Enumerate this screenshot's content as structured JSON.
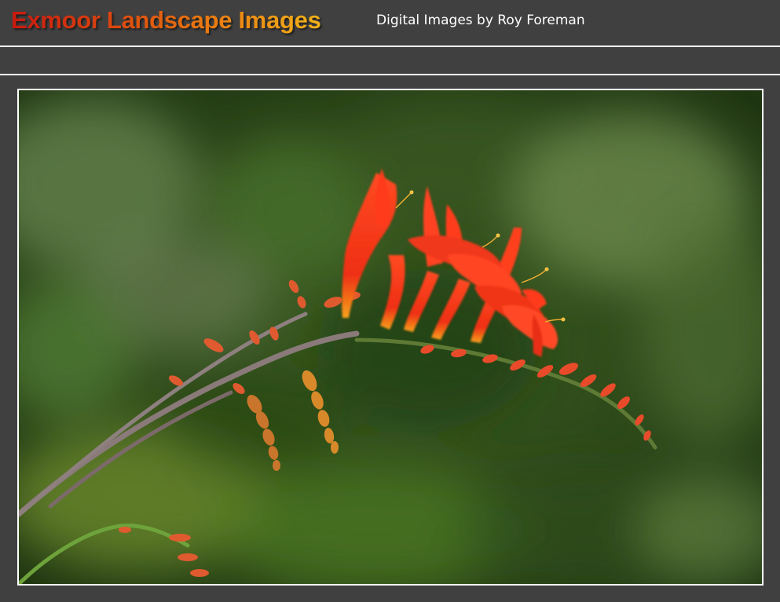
{
  "header": {
    "site_title": "Exmoor Landscape Images",
    "subtitle": "Digital Images by Roy Foreman"
  },
  "photo": {
    "subject": "flower-photo"
  },
  "colors": {
    "background": "#404040",
    "border": "#ffffff",
    "title_gradient_start": "#c8190f",
    "title_gradient_end": "#f2b21a"
  }
}
